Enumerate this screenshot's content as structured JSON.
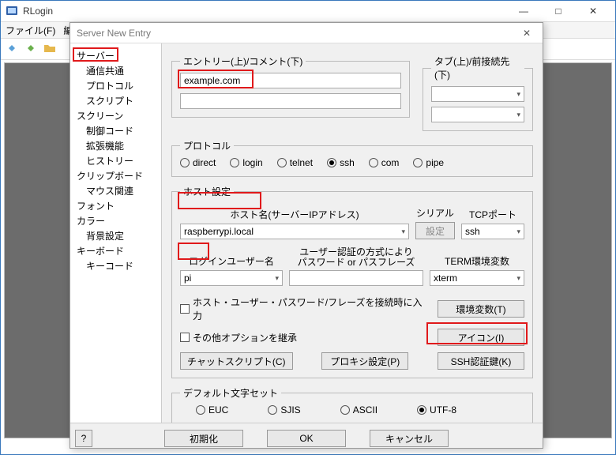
{
  "main_window": {
    "title": "RLogin",
    "menu": {
      "file": "ファイル(F)",
      "edit": "編"
    },
    "win_buttons": {
      "min": "—",
      "max": "□",
      "close": "✕"
    }
  },
  "dialog": {
    "title": "Server New Entry",
    "close": "✕",
    "tree": {
      "server": "サーバー",
      "server_children": [
        "通信共通",
        "プロトコル",
        "スクリプト"
      ],
      "screen": "スクリーン",
      "screen_children": [
        "制御コード",
        "拡張機能",
        "ヒストリー"
      ],
      "clipboard": "クリップボード",
      "clipboard_children": [
        "マウス関連"
      ],
      "font": "フォント",
      "color": "カラー",
      "color_children": [
        "背景設定"
      ],
      "keyboard": "キーボード",
      "keyboard_children": [
        "キーコード"
      ]
    },
    "entry": {
      "legend": "エントリー(上)/コメント(下)",
      "entry_value": "example.com",
      "comment_value": ""
    },
    "tab": {
      "legend": "タブ(上)/前接続先(下)"
    },
    "protocol": {
      "legend": "プロトコル",
      "options": {
        "direct": "direct",
        "login": "login",
        "telnet": "telnet",
        "ssh": "ssh",
        "com": "com",
        "pipe": "pipe"
      }
    },
    "host": {
      "legend": "ホスト設定",
      "hostname_label": "ホスト名(サーバーIPアドレス)",
      "hostname_value": "raspberrypi.local",
      "serial_label": "シリアル",
      "serial_btn": "設定",
      "tcpport_label": "TCPポート",
      "tcpport_value": "ssh",
      "login_label": "ログインユーザー名",
      "login_value": "pi",
      "auth_label1": "ユーザー認証の方式により",
      "auth_label2": "パスワード or パスフレーズ",
      "auth_value": "",
      "term_label": "TERM環境変数",
      "term_value": "xterm",
      "chk_connect": "ホスト・ユーザー・パスワード/フレーズを接続時に入力",
      "chk_inherit": "その他オプションを継承",
      "btn_env": "環境変数(T)",
      "btn_icon": "アイコン(I)",
      "btn_chat": "チャットスクリプト(C)",
      "btn_proxy": "プロキシ設定(P)",
      "btn_sshkey": "SSH認証鍵(K)"
    },
    "charset": {
      "legend": "デフォルト文字セット",
      "options": {
        "euc": "EUC",
        "sjis": "SJIS",
        "ascii": "ASCII",
        "utf8": "UTF-8"
      }
    },
    "footer": {
      "help": "?",
      "init": "初期化",
      "ok": "OK",
      "cancel": "キャンセル"
    }
  }
}
